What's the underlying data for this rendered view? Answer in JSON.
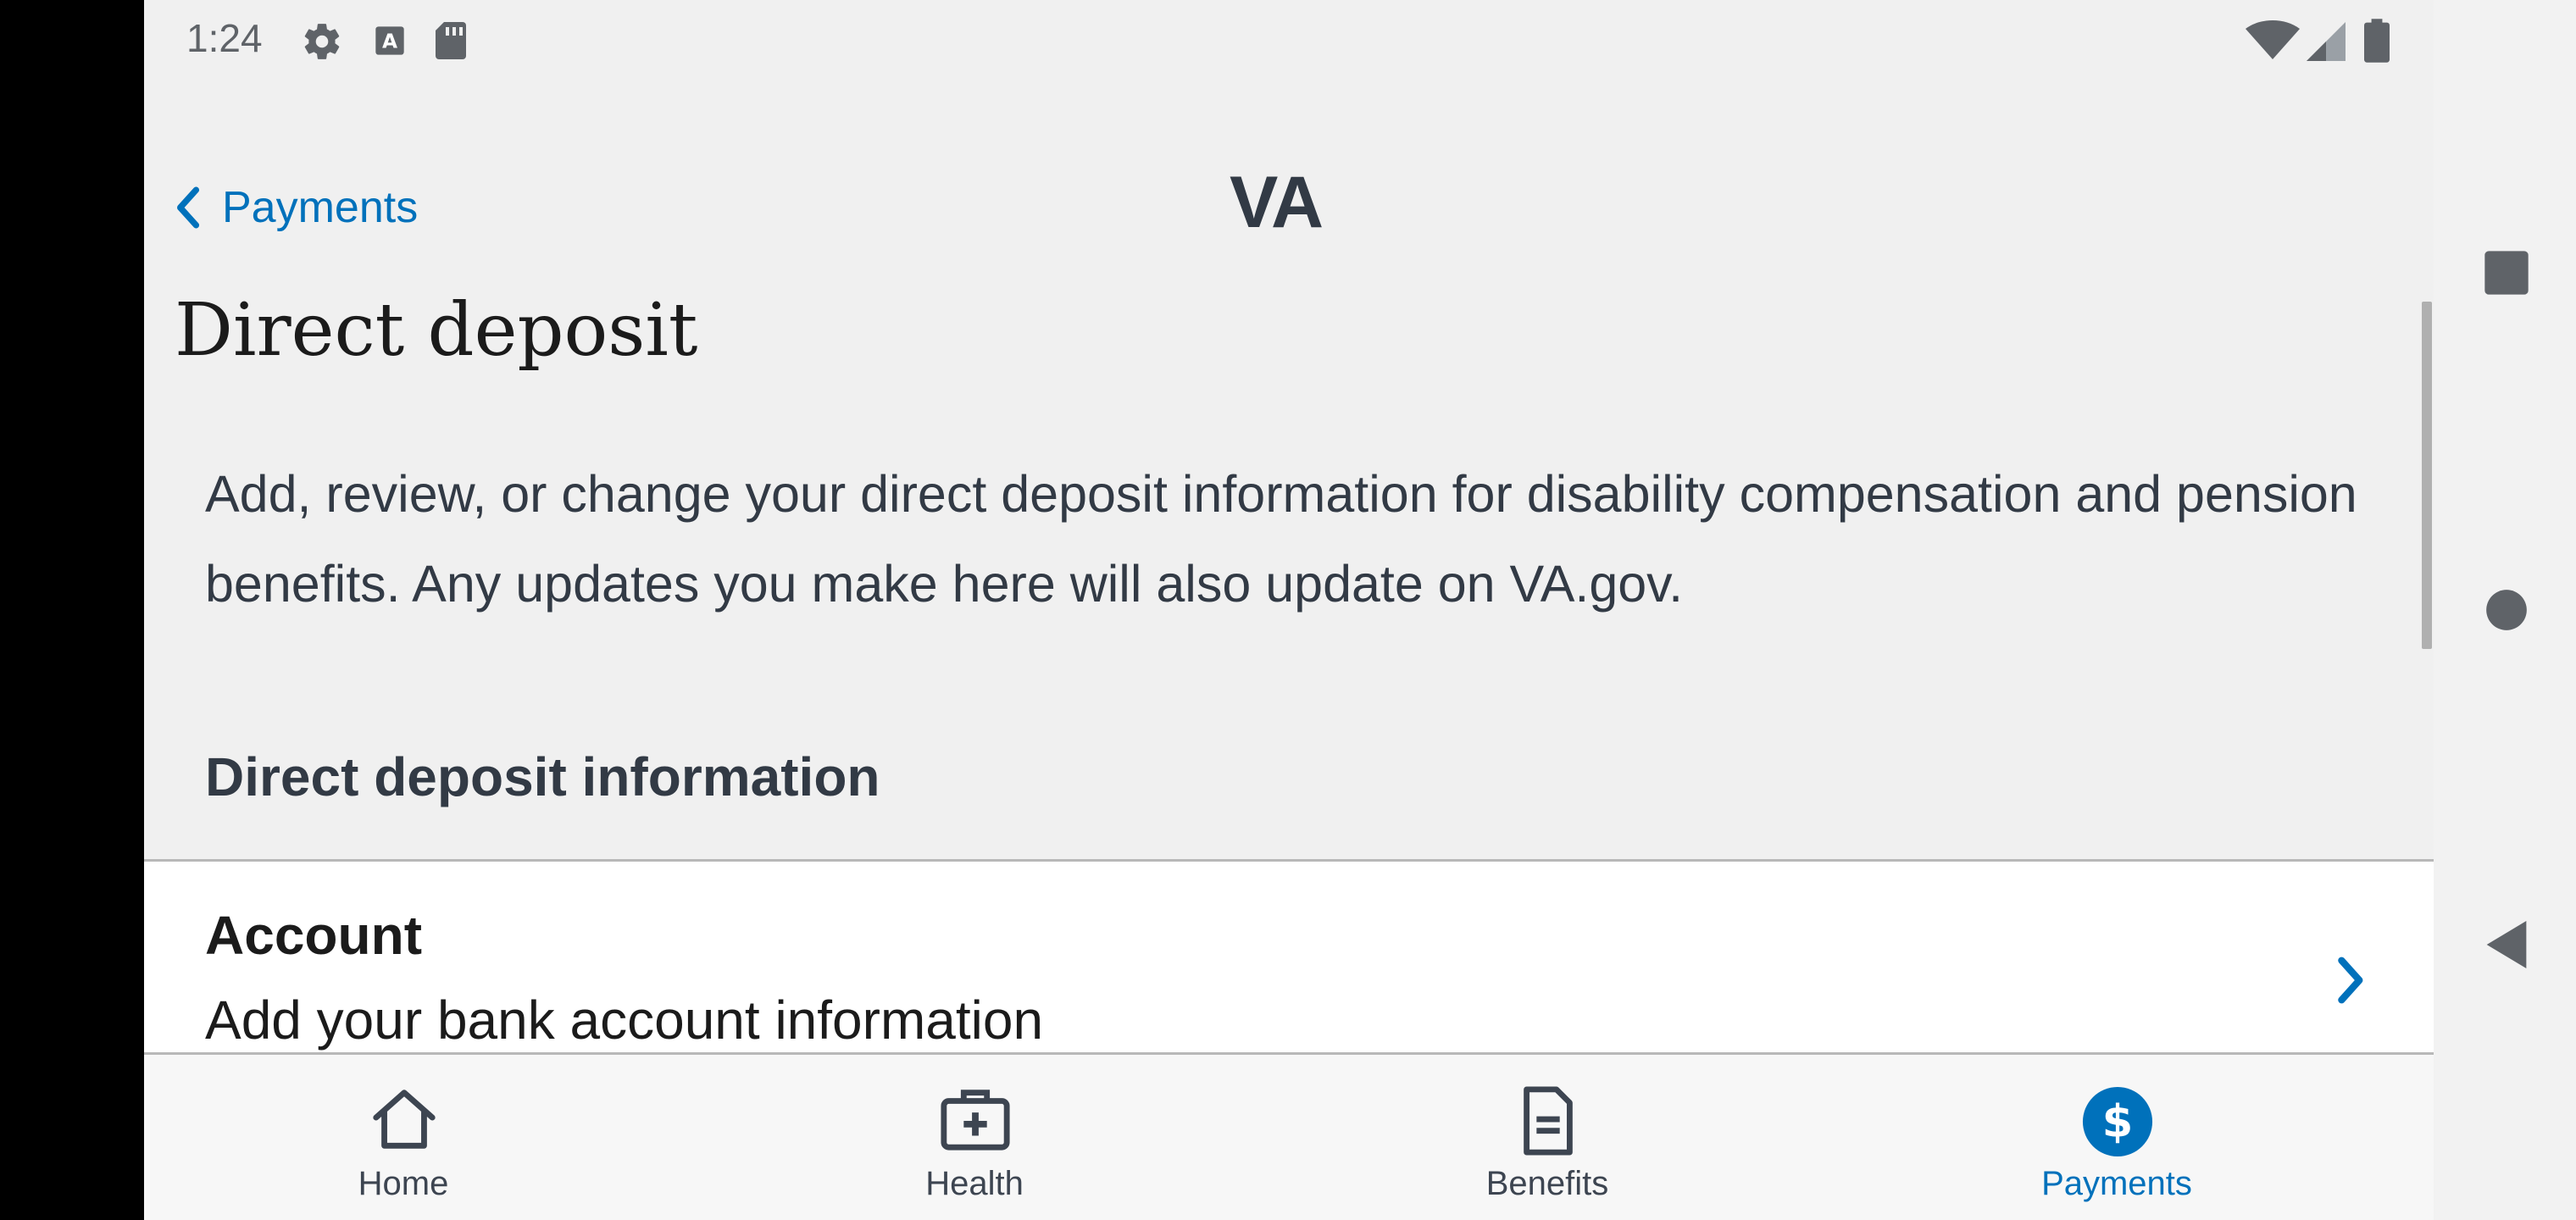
{
  "status_bar": {
    "time": "1:24",
    "icons": [
      "gear-icon",
      "keyboard-a-icon",
      "sd-card-icon",
      "wifi-icon",
      "cell-signal-icon",
      "battery-icon"
    ]
  },
  "header": {
    "back_label": "Payments",
    "logo": "VA"
  },
  "page": {
    "title": "Direct deposit",
    "description": "Add, review, or change your direct deposit information for disability compensation and pension benefits. Any updates you make here will also update on VA.gov.",
    "section_heading": "Direct deposit information",
    "account": {
      "title": "Account",
      "subtitle": "Add your bank account information"
    }
  },
  "tabs": [
    {
      "label": "Home",
      "icon": "home-icon",
      "active": false
    },
    {
      "label": "Health",
      "icon": "medical-kit-icon",
      "active": false
    },
    {
      "label": "Benefits",
      "icon": "document-icon",
      "active": false
    },
    {
      "label": "Payments",
      "icon": "dollar-icon",
      "active": true
    }
  ],
  "colors": {
    "link": "#0071bb",
    "text_dark": "#323a45",
    "background": "#f0f0f0",
    "active_tab": "#0071bb"
  }
}
